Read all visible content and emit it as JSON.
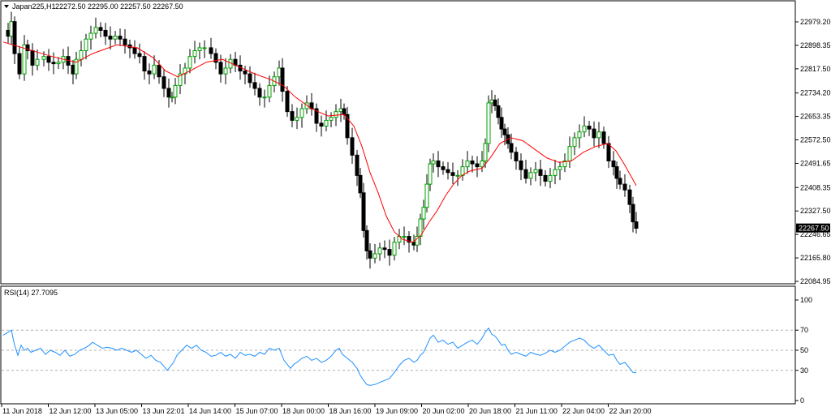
{
  "chart_data": [
    {
      "type": "candlestick",
      "title": "Japan225,H1",
      "ohlc_text": "22272.50 22295.00 22257.50 22267.50",
      "y_ticks": [
        "22979.20",
        "22898.35",
        "22817.50",
        "22734.20",
        "22653.35",
        "22572.50",
        "22491.65",
        "22408.35",
        "22327.50",
        "22246.65",
        "22165.80",
        "22084.95"
      ],
      "y_tick_values": [
        22979.2,
        22898.35,
        22817.5,
        22734.2,
        22653.35,
        22572.5,
        22491.65,
        22408.35,
        22327.5,
        22246.65,
        22165.8,
        22084.95
      ],
      "current_price": "22267.50",
      "ylim": [
        22080,
        23020
      ],
      "x_ticks": [
        "11 Jun 2018",
        "12 Jun 12:00",
        "13 Jun 05:00",
        "13 Jun 22:01",
        "14 Jun 14:00",
        "15 Jun 07:00",
        "18 Jun 00:00",
        "18 Jun 16:00",
        "19 Jun 09:00",
        "20 Jun 02:00",
        "20 Jun 18:00",
        "21 Jun 11:00",
        "22 Jun 04:00",
        "22 Jun 20:00"
      ],
      "close_path": [
        [
          0,
          22950
        ],
        [
          6,
          22930
        ],
        [
          10,
          22980
        ],
        [
          14,
          22870
        ],
        [
          20,
          22800
        ],
        [
          26,
          22900
        ],
        [
          30,
          22880
        ],
        [
          36,
          22830
        ],
        [
          42,
          22850
        ],
        [
          50,
          22860
        ],
        [
          56,
          22840
        ],
        [
          62,
          22835
        ],
        [
          68,
          22840
        ],
        [
          74,
          22860
        ],
        [
          80,
          22830
        ],
        [
          86,
          22800
        ],
        [
          90,
          22850
        ],
        [
          96,
          22880
        ],
        [
          102,
          22920
        ],
        [
          108,
          22940
        ],
        [
          114,
          22960
        ],
        [
          120,
          22950
        ],
        [
          126,
          22930
        ],
        [
          132,
          22920
        ],
        [
          138,
          22930
        ],
        [
          144,
          22920
        ],
        [
          150,
          22900
        ],
        [
          156,
          22890
        ],
        [
          162,
          22870
        ],
        [
          168,
          22860
        ],
        [
          174,
          22810
        ],
        [
          180,
          22800
        ],
        [
          186,
          22830
        ],
        [
          192,
          22790
        ],
        [
          198,
          22750
        ],
        [
          204,
          22720
        ],
        [
          208,
          22720
        ],
        [
          212,
          22760
        ],
        [
          218,
          22800
        ],
        [
          224,
          22820
        ],
        [
          230,
          22860
        ],
        [
          236,
          22880
        ],
        [
          242,
          22890
        ],
        [
          248,
          22890
        ],
        [
          256,
          22870
        ],
        [
          262,
          22840
        ],
        [
          268,
          22800
        ],
        [
          274,
          22820
        ],
        [
          280,
          22850
        ],
        [
          286,
          22830
        ],
        [
          292,
          22810
        ],
        [
          298,
          22800
        ],
        [
          304,
          22770
        ],
        [
          310,
          22750
        ],
        [
          316,
          22720
        ],
        [
          322,
          22720
        ],
        [
          328,
          22760
        ],
        [
          334,
          22790
        ],
        [
          340,
          22820
        ],
        [
          344,
          22740
        ],
        [
          350,
          22670
        ],
        [
          356,
          22640
        ],
        [
          362,
          22650
        ],
        [
          368,
          22680
        ],
        [
          374,
          22700
        ],
        [
          380,
          22680
        ],
        [
          386,
          22630
        ],
        [
          392,
          22620
        ],
        [
          398,
          22640
        ],
        [
          404,
          22650
        ],
        [
          410,
          22670
        ],
        [
          416,
          22680
        ],
        [
          420,
          22660
        ],
        [
          424,
          22580
        ],
        [
          430,
          22520
        ],
        [
          436,
          22450
        ],
        [
          440,
          22390
        ],
        [
          444,
          22260
        ],
        [
          448,
          22190
        ],
        [
          452,
          22165
        ],
        [
          458,
          22180
        ],
        [
          464,
          22200
        ],
        [
          470,
          22195
        ],
        [
          476,
          22175
        ],
        [
          482,
          22220
        ],
        [
          488,
          22240
        ],
        [
          494,
          22240
        ],
        [
          500,
          22220
        ],
        [
          506,
          22210
        ],
        [
          510,
          22240
        ],
        [
          514,
          22300
        ],
        [
          518,
          22340
        ],
        [
          522,
          22420
        ],
        [
          526,
          22490
        ],
        [
          530,
          22500
        ],
        [
          536,
          22480
        ],
        [
          542,
          22470
        ],
        [
          548,
          22460
        ],
        [
          554,
          22450
        ],
        [
          560,
          22450
        ],
        [
          566,
          22480
        ],
        [
          572,
          22500
        ],
        [
          578,
          22490
        ],
        [
          584,
          22480
        ],
        [
          590,
          22500
        ],
        [
          594,
          22560
        ],
        [
          598,
          22700
        ],
        [
          602,
          22710
        ],
        [
          606,
          22690
        ],
        [
          610,
          22650
        ],
        [
          614,
          22610
        ],
        [
          618,
          22590
        ],
        [
          622,
          22560
        ],
        [
          626,
          22530
        ],
        [
          632,
          22500
        ],
        [
          638,
          22470
        ],
        [
          644,
          22440
        ],
        [
          650,
          22460
        ],
        [
          656,
          22470
        ],
        [
          662,
          22450
        ],
        [
          668,
          22430
        ],
        [
          674,
          22450
        ],
        [
          680,
          22470
        ],
        [
          686,
          22480
        ],
        [
          692,
          22500
        ],
        [
          698,
          22550
        ],
        [
          704,
          22580
        ],
        [
          710,
          22600
        ],
        [
          716,
          22620
        ],
        [
          722,
          22610
        ],
        [
          728,
          22580
        ],
        [
          734,
          22600
        ],
        [
          740,
          22560
        ],
        [
          746,
          22500
        ],
        [
          752,
          22480
        ],
        [
          756,
          22440
        ],
        [
          760,
          22420
        ],
        [
          766,
          22400
        ],
        [
          772,
          22350
        ],
        [
          776,
          22290
        ],
        [
          780,
          22268
        ]
      ],
      "ma_path": [
        [
          0,
          22910
        ],
        [
          30,
          22885
        ],
        [
          60,
          22860
        ],
        [
          90,
          22840
        ],
        [
          110,
          22870
        ],
        [
          140,
          22900
        ],
        [
          165,
          22890
        ],
        [
          185,
          22855
        ],
        [
          200,
          22810
        ],
        [
          215,
          22790
        ],
        [
          230,
          22810
        ],
        [
          250,
          22840
        ],
        [
          270,
          22850
        ],
        [
          290,
          22825
        ],
        [
          310,
          22800
        ],
        [
          330,
          22780
        ],
        [
          345,
          22760
        ],
        [
          360,
          22720
        ],
        [
          380,
          22680
        ],
        [
          400,
          22655
        ],
        [
          420,
          22660
        ],
        [
          432,
          22620
        ],
        [
          442,
          22550
        ],
        [
          452,
          22460
        ],
        [
          462,
          22390
        ],
        [
          472,
          22310
        ],
        [
          482,
          22255
        ],
        [
          492,
          22230
        ],
        [
          505,
          22220
        ],
        [
          515,
          22245
        ],
        [
          525,
          22290
        ],
        [
          535,
          22330
        ],
        [
          545,
          22380
        ],
        [
          555,
          22420
        ],
        [
          565,
          22450
        ],
        [
          575,
          22465
        ],
        [
          590,
          22475
        ],
        [
          600,
          22510
        ],
        [
          612,
          22560
        ],
        [
          625,
          22580
        ],
        [
          640,
          22570
        ],
        [
          655,
          22540
        ],
        [
          670,
          22510
        ],
        [
          685,
          22495
        ],
        [
          700,
          22500
        ],
        [
          715,
          22530
        ],
        [
          730,
          22550
        ],
        [
          745,
          22560
        ],
        [
          755,
          22535
        ],
        [
          765,
          22490
        ],
        [
          775,
          22440
        ],
        [
          780,
          22415
        ]
      ],
      "ma_color": "#ff0000",
      "bull_color": "#00a000",
      "bear_color": "#000000"
    },
    {
      "type": "line",
      "title": "RSI(14) 27.7095",
      "ylim": [
        0,
        100
      ],
      "y_ticks": [
        "100",
        "70",
        "50",
        "30",
        "0"
      ],
      "y_tick_values": [
        100,
        70,
        50,
        30,
        0
      ],
      "levels": [
        70,
        50,
        30
      ],
      "line_color": "#1e90ff",
      "rsi_path": [
        [
          0,
          65
        ],
        [
          6,
          68
        ],
        [
          10,
          70
        ],
        [
          14,
          55
        ],
        [
          18,
          45
        ],
        [
          22,
          55
        ],
        [
          26,
          50
        ],
        [
          30,
          52
        ],
        [
          34,
          48
        ],
        [
          40,
          50
        ],
        [
          46,
          52
        ],
        [
          52,
          46
        ],
        [
          58,
          50
        ],
        [
          64,
          48
        ],
        [
          70,
          45
        ],
        [
          76,
          50
        ],
        [
          82,
          44
        ],
        [
          88,
          46
        ],
        [
          94,
          50
        ],
        [
          100,
          52
        ],
        [
          106,
          55
        ],
        [
          110,
          58
        ],
        [
          116,
          55
        ],
        [
          122,
          52
        ],
        [
          128,
          53
        ],
        [
          134,
          52
        ],
        [
          140,
          50
        ],
        [
          146,
          52
        ],
        [
          152,
          50
        ],
        [
          158,
          48
        ],
        [
          164,
          50
        ],
        [
          170,
          46
        ],
        [
          176,
          42
        ],
        [
          182,
          45
        ],
        [
          188,
          40
        ],
        [
          194,
          38
        ],
        [
          198,
          34
        ],
        [
          202,
          30
        ],
        [
          206,
          34
        ],
        [
          210,
          38
        ],
        [
          214,
          45
        ],
        [
          220,
          50
        ],
        [
          226,
          55
        ],
        [
          232,
          52
        ],
        [
          238,
          55
        ],
        [
          244,
          50
        ],
        [
          250,
          48
        ],
        [
          256,
          44
        ],
        [
          262,
          45
        ],
        [
          268,
          48
        ],
        [
          274,
          44
        ],
        [
          280,
          46
        ],
        [
          286,
          42
        ],
        [
          292,
          48
        ],
        [
          298,
          45
        ],
        [
          304,
          46
        ],
        [
          310,
          44
        ],
        [
          316,
          48
        ],
        [
          322,
          46
        ],
        [
          328,
          52
        ],
        [
          334,
          50
        ],
        [
          340,
          52
        ],
        [
          346,
          40
        ],
        [
          350,
          36
        ],
        [
          354,
          32
        ],
        [
          358,
          36
        ],
        [
          362,
          38
        ],
        [
          368,
          42
        ],
        [
          374,
          44
        ],
        [
          380,
          40
        ],
        [
          386,
          42
        ],
        [
          392,
          38
        ],
        [
          398,
          40
        ],
        [
          404,
          44
        ],
        [
          410,
          50
        ],
        [
          414,
          52
        ],
        [
          418,
          46
        ],
        [
          424,
          42
        ],
        [
          430,
          38
        ],
        [
          436,
          32
        ],
        [
          440,
          25
        ],
        [
          444,
          20
        ],
        [
          448,
          16
        ],
        [
          452,
          15
        ],
        [
          458,
          16
        ],
        [
          464,
          18
        ],
        [
          470,
          20
        ],
        [
          476,
          22
        ],
        [
          482,
          28
        ],
        [
          488,
          35
        ],
        [
          494,
          40
        ],
        [
          500,
          42
        ],
        [
          506,
          38
        ],
        [
          510,
          40
        ],
        [
          514,
          45
        ],
        [
          518,
          48
        ],
        [
          522,
          55
        ],
        [
          526,
          62
        ],
        [
          530,
          65
        ],
        [
          536,
          58
        ],
        [
          542,
          60
        ],
        [
          548,
          56
        ],
        [
          554,
          58
        ],
        [
          560,
          52
        ],
        [
          566,
          55
        ],
        [
          572,
          58
        ],
        [
          578,
          60
        ],
        [
          584,
          56
        ],
        [
          590,
          62
        ],
        [
          594,
          68
        ],
        [
          598,
          72
        ],
        [
          602,
          66
        ],
        [
          606,
          64
        ],
        [
          610,
          60
        ],
        [
          614,
          55
        ],
        [
          618,
          56
        ],
        [
          622,
          50
        ],
        [
          626,
          46
        ],
        [
          632,
          48
        ],
        [
          638,
          46
        ],
        [
          644,
          44
        ],
        [
          650,
          48
        ],
        [
          656,
          46
        ],
        [
          662,
          45
        ],
        [
          668,
          47
        ],
        [
          674,
          50
        ],
        [
          680,
          48
        ],
        [
          686,
          50
        ],
        [
          692,
          54
        ],
        [
          698,
          58
        ],
        [
          704,
          60
        ],
        [
          710,
          62
        ],
        [
          716,
          60
        ],
        [
          722,
          55
        ],
        [
          728,
          52
        ],
        [
          734,
          55
        ],
        [
          740,
          50
        ],
        [
          746,
          45
        ],
        [
          752,
          46
        ],
        [
          756,
          40
        ],
        [
          760,
          36
        ],
        [
          766,
          38
        ],
        [
          772,
          32
        ],
        [
          776,
          28
        ],
        [
          780,
          27.7
        ]
      ]
    }
  ]
}
